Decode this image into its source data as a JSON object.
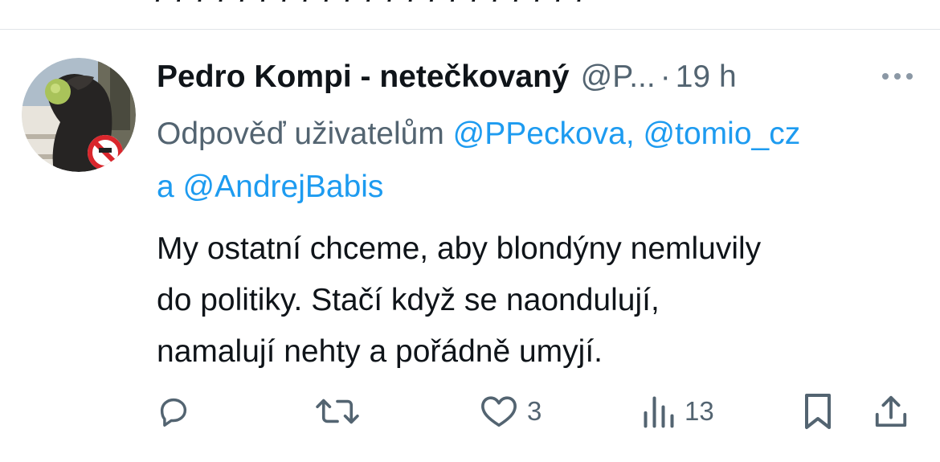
{
  "tweet": {
    "display_name": "Pedro Kompi - netečkovaný",
    "handle": "@P...",
    "separator": "·",
    "time": "19 h",
    "reply_prefix": "Odpověď uživatelům",
    "mentions": [
      "@PPeckova,",
      "@tomio_cz"
    ],
    "mention_connector": "a",
    "last_mention": "@AndrejBabis",
    "text_lines": [
      "My ostatní chceme, aby blondýny nemluvily",
      "do politiky. Stačí když se naondulují,",
      "namalují nehty a pořádně umyjí."
    ]
  },
  "actions": {
    "reply": {
      "icon": "reply-icon",
      "count": ""
    },
    "retweet": {
      "icon": "retweet-icon",
      "count": ""
    },
    "like": {
      "icon": "heart-icon",
      "count": "3"
    },
    "views": {
      "icon": "views-icon",
      "count": "13"
    },
    "bookmark": {
      "icon": "bookmark-icon"
    },
    "share": {
      "icon": "share-icon"
    }
  },
  "colors": {
    "text": "#0f1419",
    "secondary": "#536471",
    "link": "#1d9bf0",
    "divider": "#e1e5e8"
  }
}
